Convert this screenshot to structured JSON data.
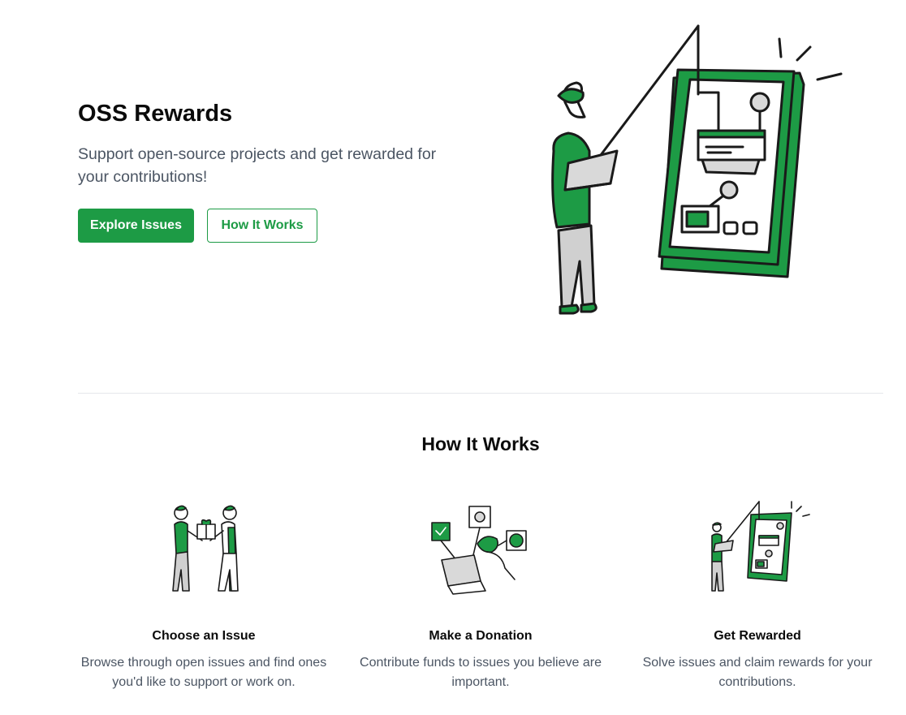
{
  "hero": {
    "title": "OSS Rewards",
    "subtitle": "Support open-source projects and get rewarded for your contributions!",
    "primary_button": "Explore Issues",
    "secondary_button": "How It Works"
  },
  "how_it_works": {
    "title": "How It Works",
    "steps": [
      {
        "title": "Choose an Issue",
        "description": "Browse through open issues and find ones you'd like to support or work on.",
        "icon": "handing-gift-illustration"
      },
      {
        "title": "Make a Donation",
        "description": "Contribute funds to issues you believe are important.",
        "icon": "person-at-laptop-illustration"
      },
      {
        "title": "Get Rewarded",
        "description": "Solve issues and claim rewards for your contributions.",
        "icon": "person-fishing-app-illustration"
      }
    ]
  },
  "colors": {
    "accent": "#1d9b45",
    "text_muted": "#4b5563",
    "divider": "#e5e7eb"
  }
}
